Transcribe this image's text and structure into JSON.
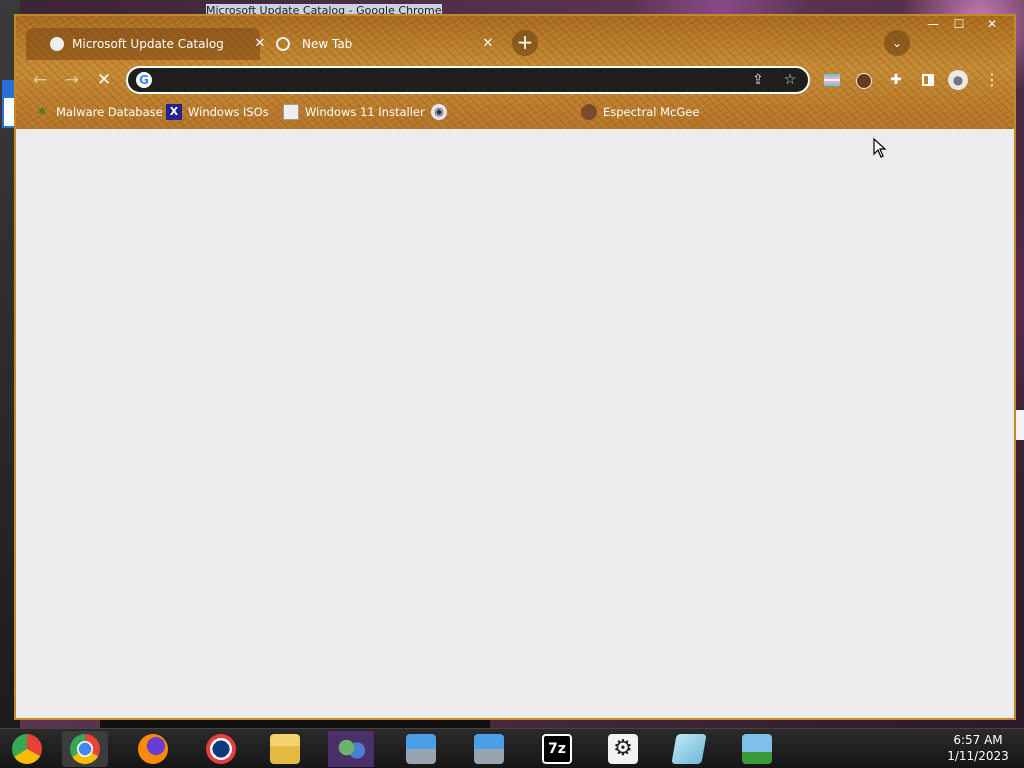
{
  "background_window": {
    "title": "Microsoft Update Catalog - Google Chrome"
  },
  "window_controls": {
    "minimize": "—",
    "maximize": "☐",
    "close": "✕"
  },
  "tabs": [
    {
      "label": "Microsoft Update Catalog",
      "active": true,
      "icon": "globe-icon"
    },
    {
      "label": "New Tab",
      "active": false,
      "icon": "chrome-icon"
    }
  ],
  "toolbar": {
    "new_tab": "+",
    "tab_search": "⌄",
    "back": "←",
    "forward": "→",
    "stop": "✕",
    "omnibox_value": "",
    "omnibox_icon": "G",
    "share": "⇪",
    "star": "☆",
    "puzzle": "✚",
    "profile": "●",
    "menu": "⋮"
  },
  "bookmarks": [
    {
      "label": "Malware Database",
      "icon": "malware-bug-icon",
      "glyph": "✱"
    },
    {
      "label": "Windows ISOs",
      "icon": "x-logo-icon",
      "glyph": "X"
    },
    {
      "label": "Windows 11 Installer",
      "icon": "installer-icon",
      "glyph": ""
    },
    {
      "label": "",
      "icon": "disc-icon",
      "glyph": "◉"
    },
    {
      "label": "Espectral McGee",
      "icon": "avatar-icon",
      "glyph": ""
    }
  ],
  "taskbar": {
    "items": [
      "start-button",
      "chrome",
      "firefox",
      "opera",
      "file-explorer",
      "people",
      "setup",
      "setup",
      "7-zip",
      "settings",
      "notepad",
      "sync"
    ],
    "sevenzip_label": "7z",
    "settings_glyph": "⚙",
    "clock_time": "6:57 AM",
    "clock_date": "1/11/2023"
  },
  "colors": {
    "frame_accent": "#c08a2a",
    "content_bg": "#ececec",
    "omnibox_bg": "#1f1f1f"
  }
}
